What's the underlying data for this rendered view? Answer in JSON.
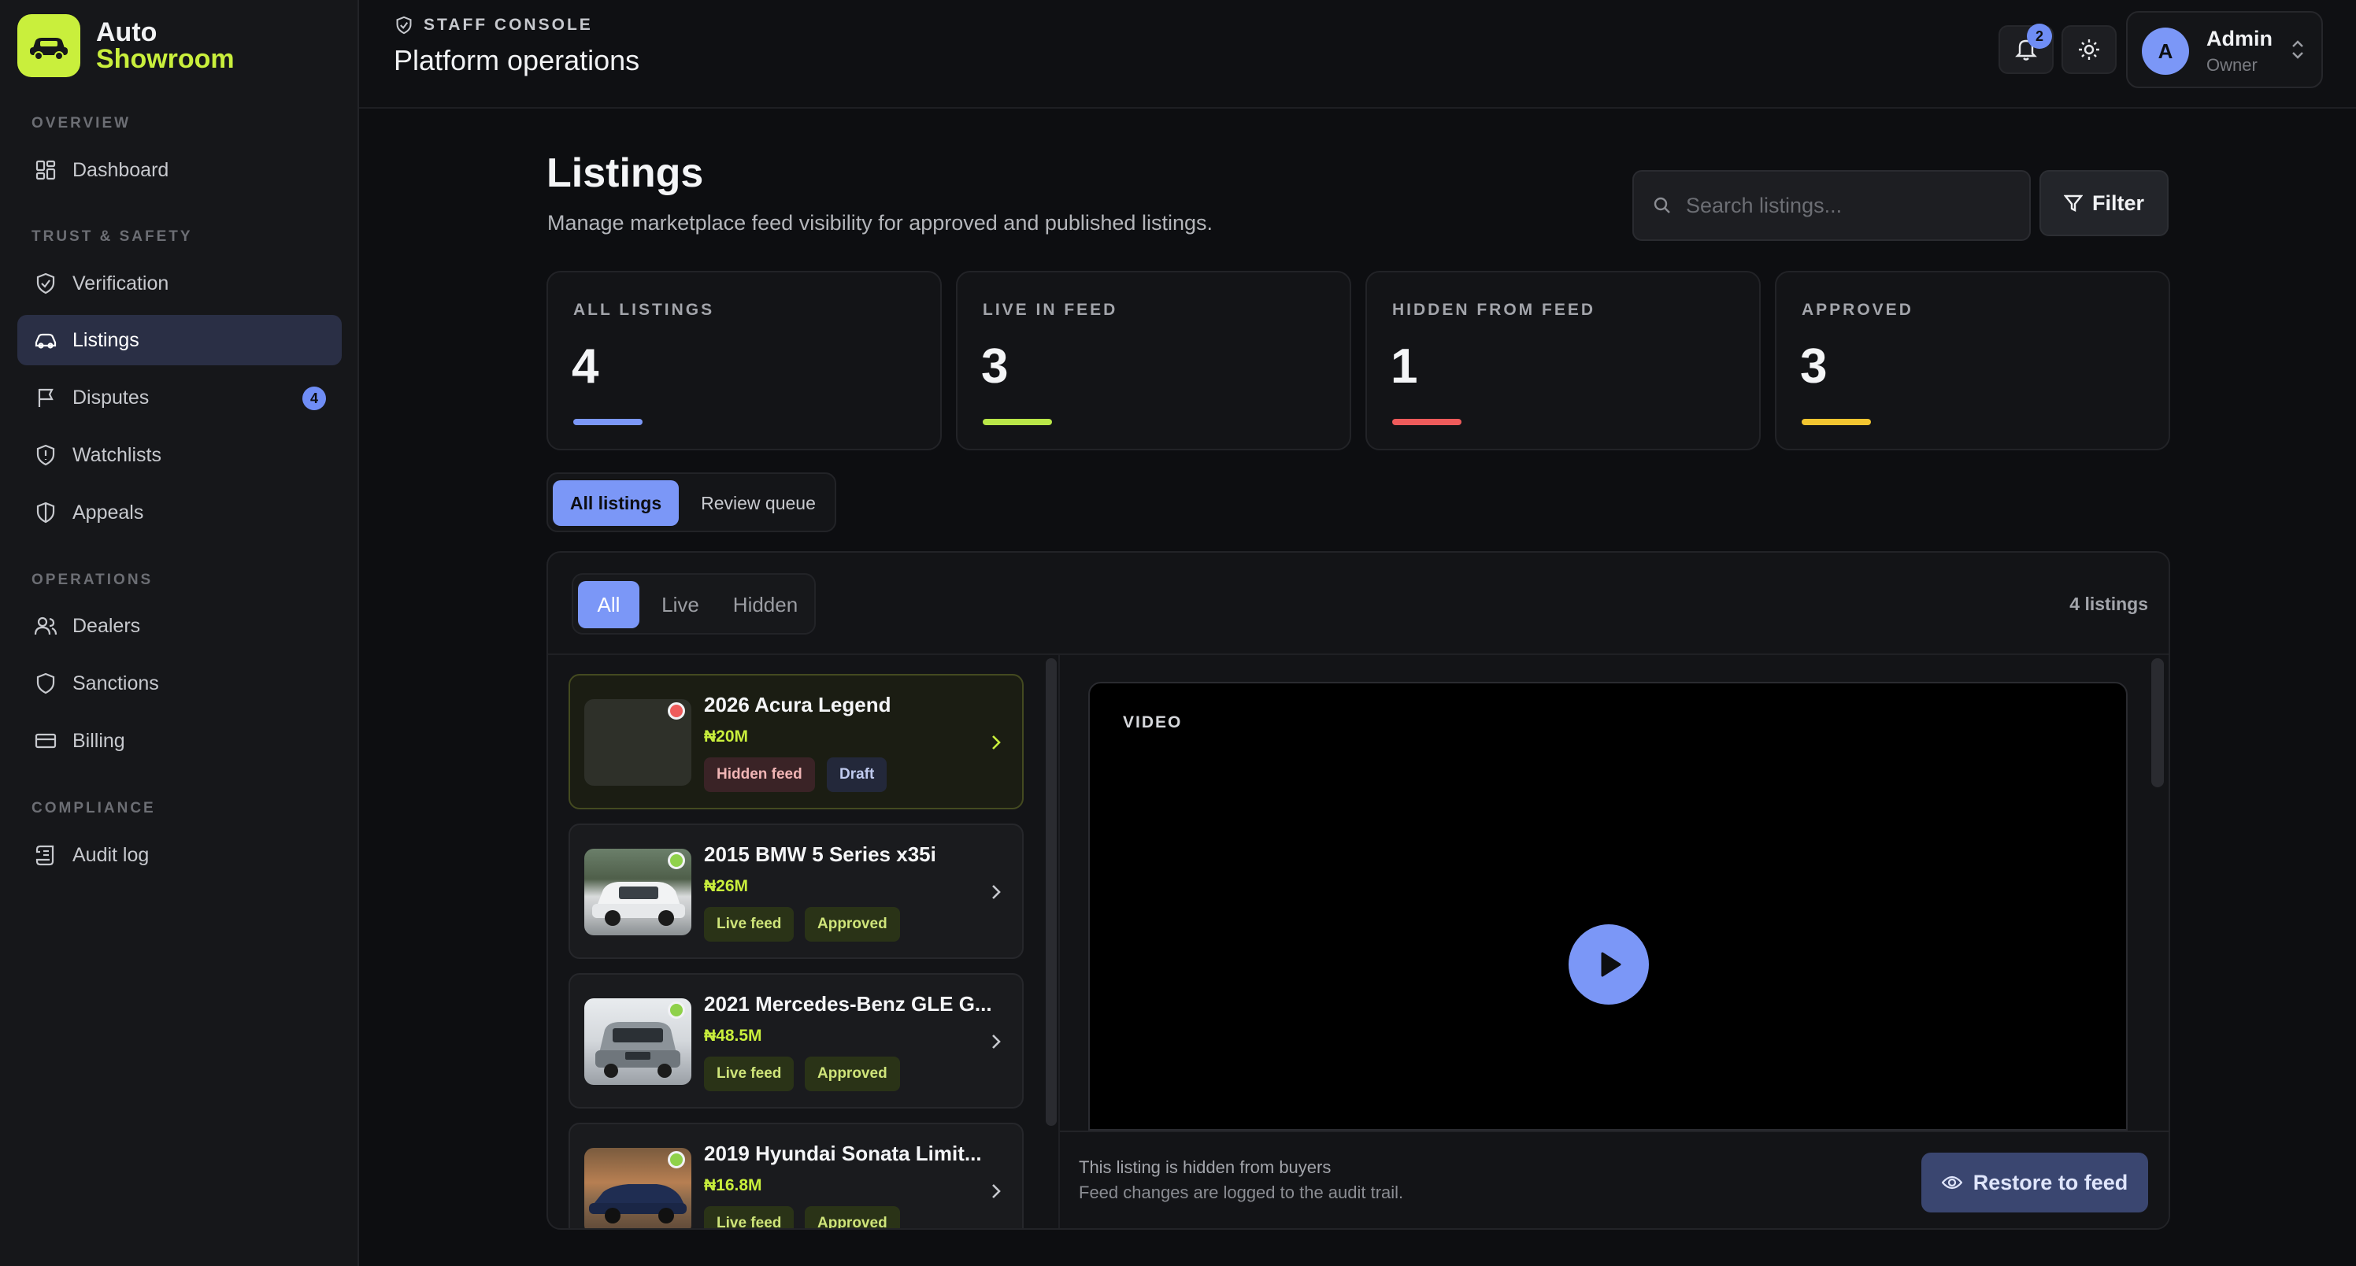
{
  "brand": {
    "line1": "Auto",
    "line2": "Showroom"
  },
  "sidebar": {
    "sections": {
      "overview": "OVERVIEW",
      "trust": "TRUST & SAFETY",
      "operations": "OPERATIONS",
      "compliance": "COMPLIANCE"
    },
    "items": {
      "dashboard": "Dashboard",
      "verification": "Verification",
      "listings": "Listings",
      "disputes": "Disputes",
      "disputes_badge": "4",
      "watchlists": "Watchlists",
      "appeals": "Appeals",
      "dealers": "Dealers",
      "sanctions": "Sanctions",
      "billing": "Billing",
      "audit": "Audit log"
    }
  },
  "header": {
    "eyebrow": "STAFF CONSOLE",
    "title": "Platform operations",
    "notif_count": "2",
    "user": {
      "initial": "A",
      "name": "Admin",
      "role": "Owner"
    }
  },
  "page": {
    "title": "Listings",
    "subtitle": "Manage marketplace feed visibility for approved and published listings.",
    "search_placeholder": "Search listings...",
    "filter_label": "Filter"
  },
  "stats": [
    {
      "label": "ALL LISTINGS",
      "value": "4",
      "color": "#7b97f7"
    },
    {
      "label": "LIVE IN FEED",
      "value": "3",
      "color": "#b9e648"
    },
    {
      "label": "HIDDEN FROM FEED",
      "value": "1",
      "color": "#ee5b5b"
    },
    {
      "label": "APPROVED",
      "value": "3",
      "color": "#f2c530"
    }
  ],
  "view_tabs": {
    "all": "All listings",
    "review": "Review queue"
  },
  "filter_tabs": {
    "all": "All",
    "live": "Live",
    "hidden": "Hidden"
  },
  "listing_count": "4 listings",
  "listings": [
    {
      "title": "2026 Acura Legend",
      "price": "₦20M",
      "chip1": "Hidden feed",
      "chip2": "Draft",
      "status_color": "#ee5b5b"
    },
    {
      "title": "2015 BMW 5 Series x35i",
      "price": "₦26M",
      "chip1": "Live feed",
      "chip2": "Approved",
      "status_color": "#8fd14a"
    },
    {
      "title": "2021 Mercedes-Benz GLE G...",
      "price": "₦48.5M",
      "chip1": "Live feed",
      "chip2": "Approved",
      "status_color": "#8fd14a"
    },
    {
      "title": "2019 Hyundai Sonata Limit...",
      "price": "₦16.8M",
      "chip1": "Live feed",
      "chip2": "Approved",
      "status_color": "#8fd14a"
    }
  ],
  "detail": {
    "video_label": "VIDEO",
    "note1": "This listing is hidden from buyers",
    "note2": "Feed changes are logged to the audit trail.",
    "restore_label": "Restore to feed"
  }
}
